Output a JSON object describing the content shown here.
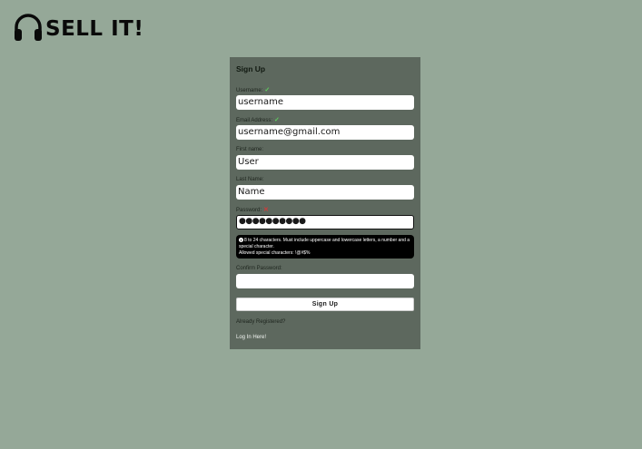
{
  "brand": {
    "name": "SELL IT!",
    "logo_icon": "headphones-icon"
  },
  "form": {
    "title": "Sign Up",
    "fields": [
      {
        "label": "Username:",
        "value": "username",
        "status": "valid"
      },
      {
        "label": "Email Address:",
        "value": "username@gmail.com",
        "status": "valid"
      },
      {
        "label": "First name:",
        "value": "User",
        "status": "none"
      },
      {
        "label": "Last Name:",
        "value": "Name",
        "status": "none"
      },
      {
        "label": "Password:",
        "value": "●●●●●●●●●●",
        "status": "invalid"
      },
      {
        "label": "Confirm Password:",
        "value": "",
        "status": "none"
      }
    ],
    "password_hint": {
      "line1": "8 to 24 characters. Must include uppercase and lowercase letters, a number and a special character.",
      "line2": "Allowed special characters: !@#$%"
    },
    "submit_label": "Sign Up",
    "already_registered": "Already Registered?",
    "login_link": "Log In Here!"
  },
  "colors": {
    "page_bg": "#95a898",
    "panel_bg": "#5d685e",
    "valid": "#5fcf5f",
    "invalid": "#d03a3a"
  }
}
